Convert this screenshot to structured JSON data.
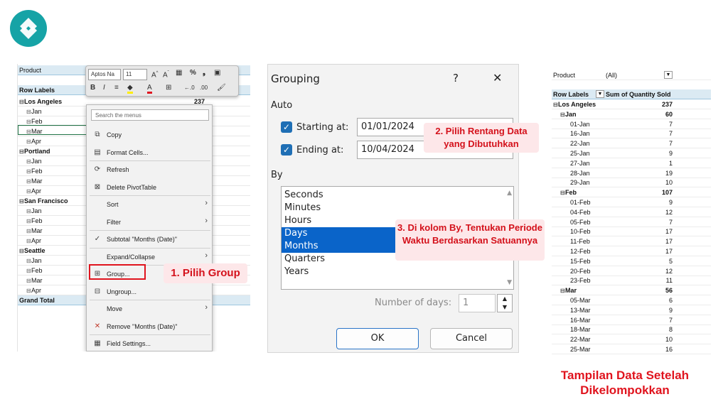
{
  "left": {
    "filter_label": "Product",
    "header_label": "Row Labels",
    "rows": [
      {
        "label": "Los Angeles",
        "level": 0,
        "value": "237"
      },
      {
        "label": "Jan",
        "level": 1
      },
      {
        "label": "Feb",
        "level": 1
      },
      {
        "label": "Mar",
        "level": 1
      },
      {
        "label": "Apr",
        "level": 1
      },
      {
        "label": "Portland",
        "level": 0
      },
      {
        "label": "Jan",
        "level": 1
      },
      {
        "label": "Feb",
        "level": 1
      },
      {
        "label": "Mar",
        "level": 1
      },
      {
        "label": "Apr",
        "level": 1
      },
      {
        "label": "San Francisco",
        "level": 0
      },
      {
        "label": "Jan",
        "level": 1
      },
      {
        "label": "Feb",
        "level": 1
      },
      {
        "label": "Mar",
        "level": 1
      },
      {
        "label": "Apr",
        "level": 1
      },
      {
        "label": "Seattle",
        "level": 0
      },
      {
        "label": "Jan",
        "level": 1
      },
      {
        "label": "Feb",
        "level": 1
      },
      {
        "label": "Mar",
        "level": 1
      },
      {
        "label": "Apr",
        "level": 1
      },
      {
        "label": "Grand Total",
        "level": -1
      }
    ],
    "minitoolbar": {
      "font_name": "Aptos Na",
      "font_size": "11",
      "icons": [
        "increase-font-icon",
        "decrease-font-icon",
        "number-format-icon",
        "percent-icon",
        "comma-icon",
        "format-table-icon",
        "bold-icon",
        "italic-icon",
        "align-icon",
        "fill-color-icon",
        "font-color-icon",
        "borders-icon",
        "decrease-decimal-icon",
        "increase-decimal-icon",
        "format-painter-icon"
      ]
    },
    "context_menu": {
      "search_placeholder": "Search the menus",
      "items": [
        {
          "label": "Copy",
          "icon": "copy-icon"
        },
        {
          "label": "Format Cells...",
          "icon": "format-cells-icon"
        },
        {
          "label": "Refresh",
          "icon": "refresh-icon"
        },
        {
          "label": "Delete PivotTable",
          "icon": "delete-pivot-icon"
        },
        {
          "label": "Sort",
          "icon": "",
          "submenu": true
        },
        {
          "label": "Filter",
          "icon": "",
          "submenu": true
        },
        {
          "label": "Subtotal \"Months (Date)\"",
          "icon": "check-icon"
        },
        {
          "label": "Expand/Collapse",
          "icon": "",
          "submenu": true
        },
        {
          "label": "Group...",
          "icon": "group-icon"
        },
        {
          "label": "Ungroup...",
          "icon": "ungroup-icon"
        },
        {
          "label": "Move",
          "icon": "",
          "submenu": true
        },
        {
          "label": "Remove \"Months (Date)\"",
          "icon": "remove-icon"
        },
        {
          "label": "Field Settings...",
          "icon": "field-settings-icon"
        }
      ]
    },
    "callout": "1. Pilih Group"
  },
  "dialog": {
    "title": "Grouping",
    "help": "?",
    "close": "✕",
    "auto_label": "Auto",
    "starting_label": "Starting at:",
    "starting_value": "01/01/2024",
    "starting_checked": true,
    "ending_label": "Ending at:",
    "ending_value": "10/04/2024",
    "ending_checked": true,
    "by_label": "By",
    "by_options": [
      {
        "label": "Seconds",
        "selected": false
      },
      {
        "label": "Minutes",
        "selected": false
      },
      {
        "label": "Hours",
        "selected": false
      },
      {
        "label": "Days",
        "selected": true
      },
      {
        "label": "Months",
        "selected": true
      },
      {
        "label": "Quarters",
        "selected": false
      },
      {
        "label": "Years",
        "selected": false
      }
    ],
    "days_label": "Number of days:",
    "days_value": "1",
    "ok_label": "OK",
    "cancel_label": "Cancel",
    "callout2": "2. Pilih Rentang Data yang Dibutuhkan",
    "callout3": "3. Di kolom By, Tentukan Periode Waktu Berdasarkan Satuannya"
  },
  "right": {
    "filter_label": "Product",
    "filter_value": "(All)",
    "row_labels": "Row Labels",
    "sum_label": "Sum of Quantity Sold",
    "rows": [
      {
        "label": "Los Angeles",
        "level": 0,
        "value": "237"
      },
      {
        "label": "Jan",
        "level": 1,
        "value": "60"
      },
      {
        "label": "01-Jan",
        "level": 2,
        "value": "7"
      },
      {
        "label": "16-Jan",
        "level": 2,
        "value": "7"
      },
      {
        "label": "22-Jan",
        "level": 2,
        "value": "7"
      },
      {
        "label": "25-Jan",
        "level": 2,
        "value": "9"
      },
      {
        "label": "27-Jan",
        "level": 2,
        "value": "1"
      },
      {
        "label": "28-Jan",
        "level": 2,
        "value": "19"
      },
      {
        "label": "29-Jan",
        "level": 2,
        "value": "10"
      },
      {
        "label": "Feb",
        "level": 1,
        "value": "107"
      },
      {
        "label": "01-Feb",
        "level": 2,
        "value": "9"
      },
      {
        "label": "04-Feb",
        "level": 2,
        "value": "12"
      },
      {
        "label": "05-Feb",
        "level": 2,
        "value": "7"
      },
      {
        "label": "10-Feb",
        "level": 2,
        "value": "17"
      },
      {
        "label": "11-Feb",
        "level": 2,
        "value": "17"
      },
      {
        "label": "12-Feb",
        "level": 2,
        "value": "17"
      },
      {
        "label": "15-Feb",
        "level": 2,
        "value": "5"
      },
      {
        "label": "20-Feb",
        "level": 2,
        "value": "12"
      },
      {
        "label": "23-Feb",
        "level": 2,
        "value": "11"
      },
      {
        "label": "Mar",
        "level": 1,
        "value": "56"
      },
      {
        "label": "05-Mar",
        "level": 2,
        "value": "6"
      },
      {
        "label": "13-Mar",
        "level": 2,
        "value": "9"
      },
      {
        "label": "16-Mar",
        "level": 2,
        "value": "7"
      },
      {
        "label": "18-Mar",
        "level": 2,
        "value": "8"
      },
      {
        "label": "22-Mar",
        "level": 2,
        "value": "10"
      },
      {
        "label": "25-Mar",
        "level": 2,
        "value": "16"
      }
    ],
    "caption": "Tampilan Data Setelah Dikelompokkan"
  },
  "colors": {
    "accent": "#16a3a6",
    "callout_text": "#d4111b",
    "callout_bg": "#fde7e9",
    "selection": "#0a64c9"
  }
}
